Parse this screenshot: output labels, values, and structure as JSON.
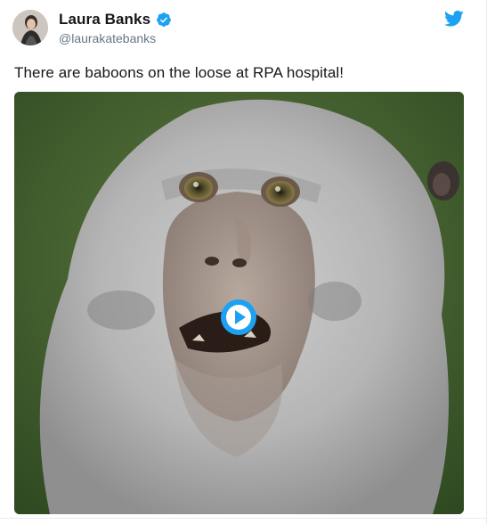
{
  "author": {
    "display_name": "Laura Banks",
    "handle": "@laurakatebanks",
    "verified": true
  },
  "tweet": {
    "text": "There are baboons on the loose at RPA hospital!"
  },
  "media": {
    "type": "video",
    "play_icon": "play-circle-icon"
  },
  "brand": {
    "icon": "twitter-bird-icon",
    "accent": "#1da1f2"
  }
}
